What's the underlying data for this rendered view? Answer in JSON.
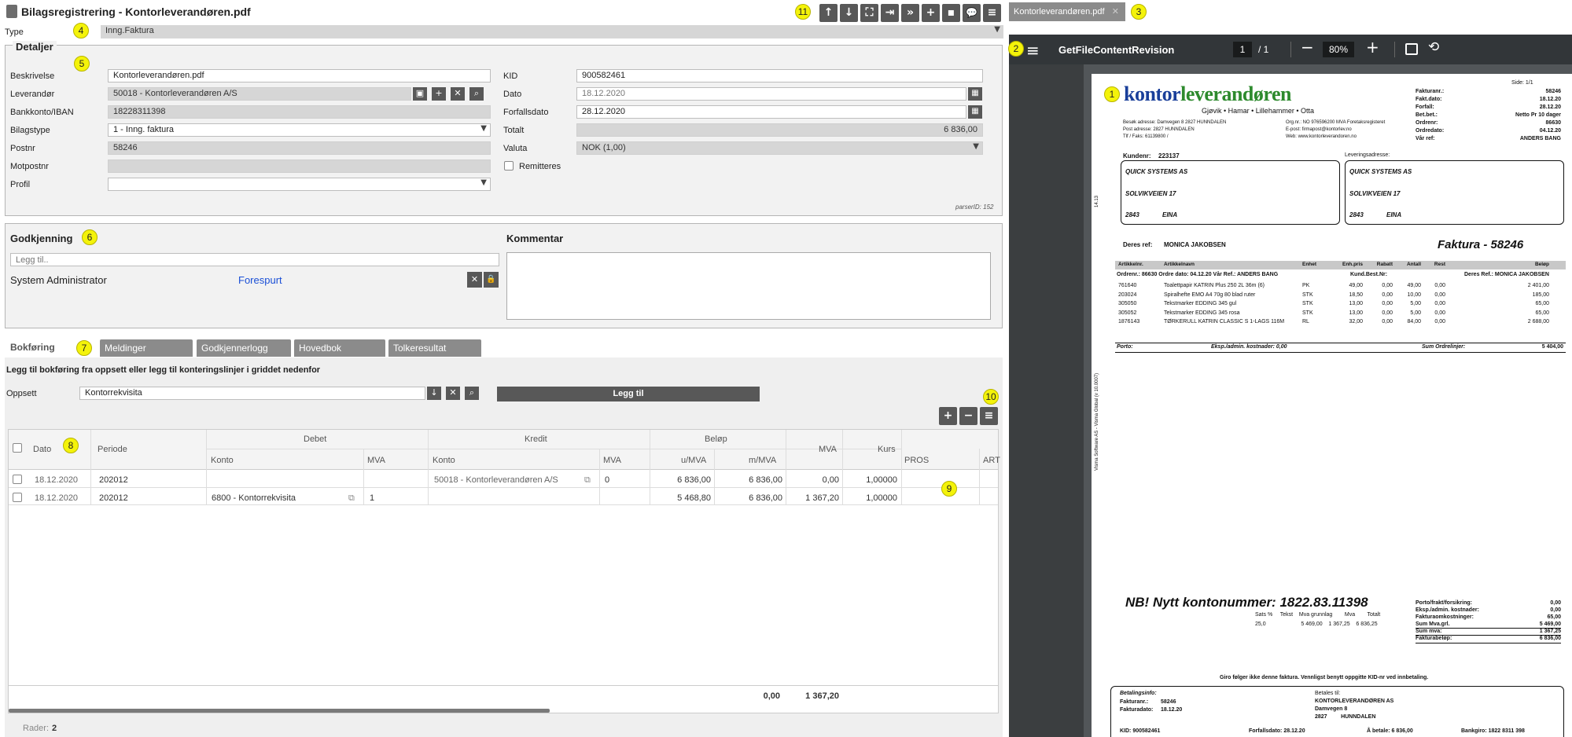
{
  "window": {
    "title": "Bilagsregistrering - Kontorleverandøren.pdf"
  },
  "type_row": {
    "label": "Type",
    "value": "Inng.Faktura"
  },
  "details": {
    "legend": "Detaljer",
    "parser_id": "parserID: 152",
    "beskrivelse_label": "Beskrivelse",
    "beskrivelse": "Kontorleverandøren.pdf",
    "leverandor_label": "Leverandør",
    "leverandor": "50018 - Kontorleverandøren A/S",
    "bankkonto_label": "Bankkonto/IBAN",
    "bankkonto": "18228311398",
    "bilagstype_label": "Bilagstype",
    "bilagstype": "1 - Inng. faktura",
    "postnr_label": "Postnr",
    "postnr": "58246",
    "motpostnr_label": "Motpostnr",
    "motpostnr": "",
    "profil_label": "Profil",
    "profil": "",
    "kid_label": "KID",
    "kid": "900582461",
    "dato_label": "Dato",
    "dato": "18.12.2020",
    "forfall_label": "Forfallsdato",
    "forfall": "28.12.2020",
    "totalt_label": "Totalt",
    "totalt": "6 836,00",
    "valuta_label": "Valuta",
    "valuta": "NOK (1,00)",
    "remitteres_label": "Remitteres"
  },
  "approval": {
    "title": "Godkjenning",
    "add_placeholder": "Legg til..",
    "user": "System Administrator",
    "status": "Forespurt",
    "comment_title": "Kommentar"
  },
  "tabs": [
    {
      "label": "Bokføring"
    },
    {
      "label": "Meldinger"
    },
    {
      "label": "Godkjennerlogg"
    },
    {
      "label": "Hovedbok"
    },
    {
      "label": "Tolkeresultat"
    }
  ],
  "booking": {
    "hint": "Legg til bokføring fra oppsett eller legg til konteringslinjer i griddet nedenfor",
    "oppsett_label": "Oppsett",
    "oppsett": "Kontorrekvisita",
    "add_button": "Legg til",
    "rows_label": "Rader:",
    "rows_count": "2",
    "sum_mva": "0,00",
    "sum_mmva": "1 367,20"
  },
  "grid": {
    "groups": {
      "debet": "Debet",
      "kredit": "Kredit",
      "belop": "Beløp"
    },
    "headers": {
      "dato": "Dato",
      "periode": "Periode",
      "konto_d": "Konto",
      "mva_d": "MVA",
      "konto_k": "Konto",
      "mva_k": "MVA",
      "umva": "u/MVA",
      "mmva": "m/MVA",
      "mva": "MVA",
      "kurs": "Kurs",
      "pros": "PROS",
      "art": "ART"
    },
    "rows": [
      {
        "dato": "18.12.2020",
        "periode": "202012",
        "konto_d": "",
        "mva_d": "",
        "konto_k": "50018 - Kontorleverandøren A/S",
        "mva_k": "0",
        "umva": "6 836,00",
        "mmva": "6 836,00",
        "mva": "0,00",
        "kurs": "1,00000"
      },
      {
        "dato": "18.12.2020",
        "periode": "202012",
        "konto_d": "6800 - Kontorrekvisita",
        "mva_d": "1",
        "konto_k": "",
        "mva_k": "",
        "umva": "5 468,80",
        "mmva": "6 836,00",
        "mva": "1 367,20",
        "kurs": "1,00000"
      }
    ]
  },
  "viewer": {
    "tab": "Kontorleverandøren.pdf",
    "doc_title": "GetFileContentRevision",
    "page": "1",
    "pages": "/ 1",
    "zoom": "80%"
  },
  "invoice": {
    "brand1": "kontor",
    "brand2": "leverandøren",
    "towns": "Gjøvik • Hamar • Lillehammer • Otta",
    "side": "Side: 1/1",
    "addr1": "Besøk adresse:  Damvegen 8     2827  HUNNDALEN",
    "addr2": "Post adresse:                2827  HUNNDALEN",
    "addr3": "Tlf / Faks:    61139800  /",
    "org": "Org.nr.:  NO 976596200 MVA  Foretaksregisteret",
    "epost": "E-post:  firmapost@kontorlev.no",
    "web": "Web:     www.kontorleverandoren.no",
    "meta": [
      [
        "Fakturanr.:",
        "58246"
      ],
      [
        "Fakt.dato:",
        "18.12.20"
      ],
      [
        "Forfall:",
        "28.12.20"
      ],
      [
        "Bet.bet.:",
        "Netto Pr 10 dager"
      ],
      [
        "Ordrenr:",
        "86630"
      ],
      [
        "Ordredato:",
        "04.12.20"
      ],
      [
        "Vår ref:",
        "ANDERS BANG"
      ]
    ],
    "kundenr_label": "Kundenr:",
    "kundenr": "223137",
    "lev_label": "Leveringsadresse:",
    "cust_name": "QUICK SYSTEMS AS",
    "cust_street": "SOLVIKVEIEN 17",
    "cust_zip": "2843",
    "cust_city": "EINA",
    "deres_label": "Deres ref:",
    "deres": "MONICA JAKOBSEN",
    "faktura_title": "Faktura - 58246",
    "cols": [
      "Artikkelnr.",
      "Artikkelnavn",
      "Enhet",
      "Enh.pris",
      "Rabatt",
      "Antall",
      "Rest",
      "Beløp"
    ],
    "order_line": "Ordrenr.:   86630    Ordre dato:  04.12.20   Vår Ref.:   ANDERS BANG",
    "order_line2": "Kund.Best.Nr:",
    "order_line3": "Deres Ref.:  MONICA JAKOBSEN",
    "items": [
      [
        "761640",
        "Toalettpapir KATRIN Plus 250 2L 36m (6)",
        "PK",
        "49,00",
        "0,00",
        "49,00",
        "0,00",
        "2 401,00"
      ],
      [
        "203024",
        "Spiralhefte EMO A4 70g 80 blad ruter",
        "STK",
        "18,50",
        "0,00",
        "10,00",
        "0,00",
        "185,00"
      ],
      [
        "305050",
        "Tekstmarker EDDING 345 gul",
        "STK",
        "13,00",
        "0,00",
        "5,00",
        "0,00",
        "65,00"
      ],
      [
        "305052",
        "Tekstmarker EDDING 345 rosa",
        "STK",
        "13,00",
        "0,00",
        "5,00",
        "0,00",
        "65,00"
      ],
      [
        "1876143",
        "TØRKERULL KATRIN CLASSIC S 1-LAGS 116M",
        "RL",
        "32,00",
        "0,00",
        "84,00",
        "0,00",
        "2 688,00"
      ]
    ],
    "porto": "Porto:",
    "eksp": "Eksp./admin. kostnader:   0,00",
    "sum_ordre": "Sum Ordrelinjer:",
    "sum_ordre_val": "5 404,00",
    "nb": "NB! Nytt kontonummer: 1822.83.11398",
    "vat_head": "Sats %     Tekst    Mva grunnlag        Mva        Totalt",
    "vat_row": "25,0                       5 469,00    1 367,25    6 836,25",
    "totals": [
      [
        "Porto/frakt/forsikring:",
        "0,00"
      ],
      [
        "Eksp./admin. kostnader:",
        "0,00"
      ],
      [
        "Fakturaomkostninger:",
        "65,00"
      ],
      [
        "Sum Mva.grl.",
        "5 469,00"
      ],
      [
        "Sum mva:",
        "1 367,25"
      ],
      [
        "Fakturabeløp:",
        "6 836,00"
      ]
    ],
    "giro": "Giro følger ikke denne faktura. Vennligst benytt oppgitte KID-nr ved innbetaling.",
    "betinfo": "Betalingsinfo:",
    "bet_fnr": "Fakturanr.:",
    "bet_fnr_v": "58246",
    "bet_fdato": "Fakturadato:",
    "bet_fdato_v": "18.12.20",
    "betales": "Betales til:",
    "bet_navn": "KONTORLEVERANDØREN AS",
    "bet_adr": "Damvegen 8",
    "bet_post": "2827         HUNNDALEN",
    "kid_line": "KID: 900582461",
    "forf_line": "Forfallsdato: 28.12.20",
    "abet_line": "Å betale:   6 836,00",
    "bankgiro_line": "Bankgiro:   1822 8311 398",
    "side_text": "Visma Software AS - Visma Global  (v 10.0007)",
    "side_num": "14.13"
  },
  "badges": [
    "1",
    "2",
    "3",
    "4",
    "5",
    "6",
    "7",
    "8",
    "9",
    "10",
    "11"
  ]
}
